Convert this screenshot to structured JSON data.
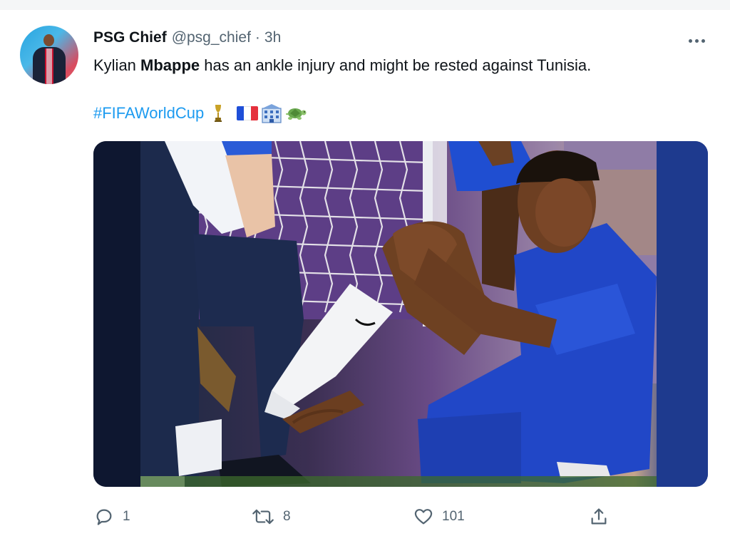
{
  "tweet": {
    "author_name": "PSG Chief",
    "author_handle": "@psg_chief",
    "separator": "·",
    "time_ago": "3h",
    "text_prefix": "Kylian ",
    "text_bold": "Mbappe",
    "text_suffix": " has an ankle injury and might be rested against Tunisia.",
    "hashtag": "#FIFAWorldCup",
    "emojis": [
      "trophy-icon",
      "france-flag-icon",
      "building-icon",
      "turtle-icon"
    ]
  },
  "actions": {
    "reply_count": "1",
    "retweet_count": "8",
    "like_count": "101"
  },
  "colors": {
    "link": "#1d9bf0",
    "secondary_text": "#536471",
    "primary_text": "#0f1419"
  }
}
